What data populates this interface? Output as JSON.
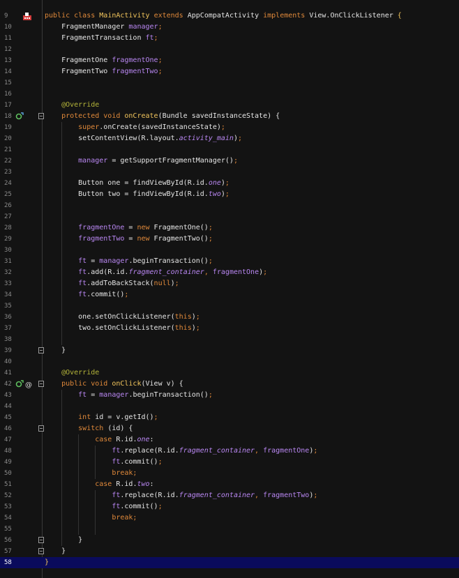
{
  "editor": {
    "current_line": 58,
    "lines": [
      {
        "n": "9",
        "segs": [
          [
            "public class ",
            "kw"
          ],
          [
            "MainActivity ",
            "fn"
          ],
          [
            "extends ",
            "kw"
          ],
          [
            "AppCompatActivity ",
            ""
          ],
          [
            "implements ",
            "kw"
          ],
          [
            "View.OnClickListener ",
            ""
          ],
          [
            "{",
            "fn"
          ]
        ]
      },
      {
        "n": "10",
        "segs": [
          [
            "    FragmentManager ",
            ""
          ],
          [
            "manager",
            "field"
          ],
          [
            ";",
            "kw"
          ]
        ]
      },
      {
        "n": "11",
        "segs": [
          [
            "    FragmentTransaction ",
            ""
          ],
          [
            "ft",
            "field"
          ],
          [
            ";",
            "kw"
          ]
        ]
      },
      {
        "n": "12",
        "segs": []
      },
      {
        "n": "13",
        "segs": [
          [
            "    FragmentOne ",
            ""
          ],
          [
            "fragmentOne",
            "field"
          ],
          [
            ";",
            "kw"
          ]
        ]
      },
      {
        "n": "14",
        "segs": [
          [
            "    FragmentTwo ",
            ""
          ],
          [
            "fragmentTwo",
            "field"
          ],
          [
            ";",
            "kw"
          ]
        ]
      },
      {
        "n": "15",
        "segs": []
      },
      {
        "n": "16",
        "segs": []
      },
      {
        "n": "17",
        "segs": [
          [
            "    @Override",
            "ann"
          ]
        ]
      },
      {
        "n": "18",
        "segs": [
          [
            "    protected void ",
            "kw"
          ],
          [
            "onCreate",
            "fn"
          ],
          [
            "(Bundle savedInstanceState) {",
            ""
          ]
        ]
      },
      {
        "n": "19",
        "segs": [
          [
            "        super",
            "kw"
          ],
          [
            ".onCreate(savedInstanceState)",
            ""
          ],
          [
            ";",
            "kw"
          ]
        ]
      },
      {
        "n": "20",
        "segs": [
          [
            "        setContentView(R.layout.",
            ""
          ],
          [
            "activity_main",
            "it"
          ],
          [
            ")",
            ""
          ],
          [
            ";",
            "kw"
          ]
        ]
      },
      {
        "n": "21",
        "segs": []
      },
      {
        "n": "22",
        "segs": [
          [
            "        manager",
            "field"
          ],
          [
            " = getSupportFragmentManager()",
            ""
          ],
          [
            ";",
            "kw"
          ]
        ]
      },
      {
        "n": "23",
        "segs": []
      },
      {
        "n": "24",
        "segs": [
          [
            "        Button one = findViewById(R.id.",
            ""
          ],
          [
            "one",
            "it"
          ],
          [
            ")",
            ""
          ],
          [
            ";",
            "kw"
          ]
        ]
      },
      {
        "n": "25",
        "segs": [
          [
            "        Button two = findViewById(R.id.",
            ""
          ],
          [
            "two",
            "it"
          ],
          [
            ")",
            ""
          ],
          [
            ";",
            "kw"
          ]
        ]
      },
      {
        "n": "26",
        "segs": []
      },
      {
        "n": "27",
        "segs": []
      },
      {
        "n": "28",
        "segs": [
          [
            "        fragmentOne",
            "field"
          ],
          [
            " = ",
            ""
          ],
          [
            "new ",
            "kw"
          ],
          [
            "FragmentOne()",
            ""
          ],
          [
            ";",
            "kw"
          ]
        ]
      },
      {
        "n": "29",
        "segs": [
          [
            "        fragmentTwo",
            "field"
          ],
          [
            " = ",
            ""
          ],
          [
            "new ",
            "kw"
          ],
          [
            "FragmentTwo()",
            ""
          ],
          [
            ";",
            "kw"
          ]
        ]
      },
      {
        "n": "30",
        "segs": []
      },
      {
        "n": "31",
        "segs": [
          [
            "        ft",
            "field"
          ],
          [
            " = ",
            ""
          ],
          [
            "manager",
            "field"
          ],
          [
            ".beginTransaction()",
            ""
          ],
          [
            ";",
            "kw"
          ]
        ]
      },
      {
        "n": "32",
        "segs": [
          [
            "        ft",
            "field"
          ],
          [
            ".add(R.id.",
            ""
          ],
          [
            "fragment_container",
            "it"
          ],
          [
            ", ",
            "kw"
          ],
          [
            "fragmentOne",
            "field"
          ],
          [
            ")",
            ""
          ],
          [
            ";",
            "kw"
          ]
        ]
      },
      {
        "n": "33",
        "segs": [
          [
            "        ft",
            "field"
          ],
          [
            ".addToBackStack(",
            ""
          ],
          [
            "null",
            "kw"
          ],
          [
            ")",
            ""
          ],
          [
            ";",
            "kw"
          ]
        ]
      },
      {
        "n": "34",
        "segs": [
          [
            "        ft",
            "field"
          ],
          [
            ".commit()",
            ""
          ],
          [
            ";",
            "kw"
          ]
        ]
      },
      {
        "n": "35",
        "segs": []
      },
      {
        "n": "36",
        "segs": [
          [
            "        one.setOnClickListener(",
            ""
          ],
          [
            "this",
            "kw"
          ],
          [
            ")",
            ""
          ],
          [
            ";",
            "kw"
          ]
        ]
      },
      {
        "n": "37",
        "segs": [
          [
            "        two.setOnClickListener(",
            ""
          ],
          [
            "this",
            "kw"
          ],
          [
            ")",
            ""
          ],
          [
            ";",
            "kw"
          ]
        ]
      },
      {
        "n": "38",
        "segs": []
      },
      {
        "n": "39",
        "segs": [
          [
            "    }",
            ""
          ]
        ]
      },
      {
        "n": "40",
        "segs": []
      },
      {
        "n": "41",
        "segs": [
          [
            "    @Override",
            "ann"
          ]
        ]
      },
      {
        "n": "42",
        "segs": [
          [
            "    public void ",
            "kw"
          ],
          [
            "onClick",
            "fn"
          ],
          [
            "(View v) {",
            ""
          ]
        ]
      },
      {
        "n": "43",
        "segs": [
          [
            "        ft",
            "field"
          ],
          [
            " = ",
            ""
          ],
          [
            "manager",
            "field"
          ],
          [
            ".beginTransaction()",
            ""
          ],
          [
            ";",
            "kw"
          ]
        ]
      },
      {
        "n": "44",
        "segs": []
      },
      {
        "n": "45",
        "segs": [
          [
            "        int ",
            "kw"
          ],
          [
            "id = v.getId()",
            ""
          ],
          [
            ";",
            "kw"
          ]
        ]
      },
      {
        "n": "46",
        "segs": [
          [
            "        switch ",
            "kw"
          ],
          [
            "(id) {",
            ""
          ]
        ]
      },
      {
        "n": "47",
        "segs": [
          [
            "            case ",
            "kw"
          ],
          [
            "R.id.",
            ""
          ],
          [
            "one",
            "it"
          ],
          [
            ":",
            ""
          ]
        ]
      },
      {
        "n": "48",
        "segs": [
          [
            "                ft",
            "field"
          ],
          [
            ".replace(R.id.",
            ""
          ],
          [
            "fragment_container",
            "it"
          ],
          [
            ", ",
            "kw"
          ],
          [
            "fragmentOne",
            "field"
          ],
          [
            ")",
            ""
          ],
          [
            ";",
            "kw"
          ]
        ]
      },
      {
        "n": "49",
        "segs": [
          [
            "                ft",
            "field"
          ],
          [
            ".commit()",
            ""
          ],
          [
            ";",
            "kw"
          ]
        ]
      },
      {
        "n": "50",
        "segs": [
          [
            "                break;",
            "kw"
          ]
        ]
      },
      {
        "n": "51",
        "segs": [
          [
            "            case ",
            "kw"
          ],
          [
            "R.id.",
            ""
          ],
          [
            "two",
            "it"
          ],
          [
            ":",
            ""
          ]
        ]
      },
      {
        "n": "52",
        "segs": [
          [
            "                ft",
            "field"
          ],
          [
            ".replace(R.id.",
            ""
          ],
          [
            "fragment_container",
            "it"
          ],
          [
            ", ",
            "kw"
          ],
          [
            "fragmentTwo",
            "field"
          ],
          [
            ")",
            ""
          ],
          [
            ";",
            "kw"
          ]
        ]
      },
      {
        "n": "53",
        "segs": [
          [
            "                ft",
            "field"
          ],
          [
            ".commit()",
            ""
          ],
          [
            ";",
            "kw"
          ]
        ]
      },
      {
        "n": "54",
        "segs": [
          [
            "                break;",
            "kw"
          ]
        ]
      },
      {
        "n": "55",
        "segs": []
      },
      {
        "n": "56",
        "segs": [
          [
            "        }",
            ""
          ]
        ]
      },
      {
        "n": "57",
        "segs": [
          [
            "    }",
            ""
          ]
        ]
      },
      {
        "n": "58",
        "segs": [
          [
            "}",
            "fn"
          ]
        ]
      }
    ],
    "gutter_icons": [
      {
        "line": "9",
        "icon": "android-activity-icon"
      },
      {
        "line": "18",
        "icon": "override-method-icon"
      },
      {
        "line": "42",
        "icon": "implements-method-icon"
      },
      {
        "line": "42",
        "icon": "at-annotation-icon"
      }
    ],
    "fold_markers": [
      "18",
      "39",
      "42",
      "46",
      "56",
      "57"
    ],
    "colors": {
      "background": "#131313",
      "keyword": "#e0893a",
      "field": "#b987f2",
      "annotation": "#b5b53a",
      "function": "#f2c55c",
      "text": "#e6e6e6",
      "current_line": "#0a0b5c"
    }
  }
}
